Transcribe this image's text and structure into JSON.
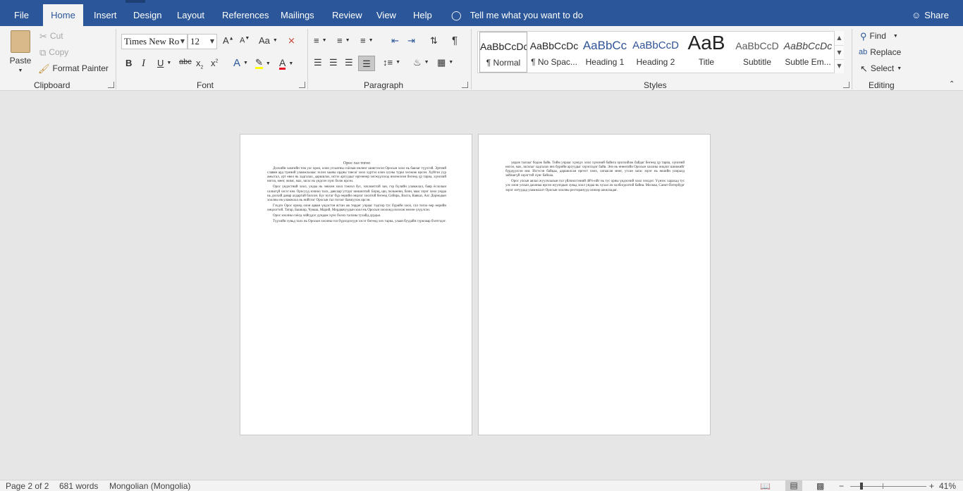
{
  "tabs": [
    {
      "label": "File",
      "active": false
    },
    {
      "label": "Home",
      "active": true
    },
    {
      "label": "Insert",
      "active": false
    },
    {
      "label": "Design",
      "active": false
    },
    {
      "label": "Layout",
      "active": false
    },
    {
      "label": "References",
      "active": false
    },
    {
      "label": "Mailings",
      "active": false
    },
    {
      "label": "Review",
      "active": false
    },
    {
      "label": "View",
      "active": false
    },
    {
      "label": "Help",
      "active": false
    }
  ],
  "tell_me": "Tell me what you want to do",
  "share_label": "Share",
  "clipboard": {
    "group_label": "Clipboard",
    "paste": "Paste",
    "cut": "Cut",
    "copy": "Copy",
    "format_painter": "Format Painter"
  },
  "font": {
    "group_label": "Font",
    "family": "Times New Ro",
    "size": "12"
  },
  "paragraph": {
    "group_label": "Paragraph"
  },
  "styles": {
    "group_label": "Styles",
    "items": [
      {
        "sample": "AaBbCcDc",
        "name": "¶ Normal",
        "selected": true
      },
      {
        "sample": "AaBbCcDc",
        "name": "¶ No Spac..."
      },
      {
        "sample": "AaBbCc",
        "name": "Heading 1"
      },
      {
        "sample": "AaBbCcD",
        "name": "Heading 2"
      },
      {
        "sample": "AaB",
        "name": "Title"
      },
      {
        "sample": "AaBbCcD",
        "name": "Subtitle"
      },
      {
        "sample": "AaBbCcDc",
        "name": "Subtle Em..."
      }
    ]
  },
  "editing": {
    "group_label": "Editing",
    "find": "Find",
    "replace": "Replace",
    "select": "Select"
  },
  "document": {
    "page1": {
      "title": "Орос гал тогоо",
      "paragraphs": [
        "Дэлхийн хамгийн том улс орон, олон угсаатны соёлын нөлөөг шингээсэн Оросын хоол нь баялаг түүхтэй. Эртний славян ард түмний уламжлалаас эхлэн хааны ордны тансаг хоол хүртэл олон зууны турш хөгжиж ирсэн. Хүйтэн уур амьсгал, урт өвөл нь хадгалах, даршилах, исгэх аргуудыг өргөнөөр хөгжүүлэхэд нөлөөлсөн бөгөөд үр тариа, хүнсний ногоо, мөөг, жимс, мах, загас нь үндсэн хүнс болж ирсэн.",
        "Орос үндэстний хоол, ундаа нь зөвхөн хоол тэжээл бус, зочломтгой зан, гэр бүлийн уламжлал, баяр ёслолын салшгүй хэсэг юм. Оросууд зочноо талх, давсаар угтдаг заншилтай. Борщ, щи, пельмени, блин, квас зэрэг хоол ундаа нь дэлхий даяар алдартай болсон. Бүс нутаг бүр өөрийн онцлог хоолтой бөгөөд Сибирь, Волга, Кавказ, Алс Дорнодын хоолны өв уламжлал нь нийтлэг Оросын гал тогоог баяжуулж ирсэн.",
        "Гэхдээ Орос оронд олон арван үндэстэн ястан аж төрдөг учраас тэдгээр тус бүрийн хоол, гал тогоо өөр өөрийн онцлогтой. Татар, Башкир, Чуваш, Марий, Мордвачуудын хоол нь Оросын хоолонд ихээхэн нөлөө үзүүлсэн.",
        "Орос хоолны соёлд хийгддэг дундаж хүнс болох талхны тухайд дурдья.",
        "Түүхийн хувьд талх нь Оросын хоолны гол бүрэлдэхүүн хэсэг бөгөөд хөх тариа, улаан буудайн гурилаар бэлтгэдэг."
      ]
    },
    "page2": {
      "paragraphs": [
        "уядаж талхыг бодож байв. Тийм учраас хүмүүс хоол хүнсний байнга эрэлхийлж байдаг бөгөөд үр тариа, хүнсний ногоо, мах, загасыг хадгалах янз бүрийн аргуудыг хэрэглэдэг байв. Энэ нь өнөөгийн Оросын хоолны онцлог шинжийг бүрдүүлсэн юм. Исгэсэн байцаа, даршилсан өргөст хэмх, хатаасан мөөг, утсан загас зэрэг нь өвлийн улиралд зайлшгүй хэрэгтэй хүнс байлаа.",
        "Орос улсын аялал жуулчлалын гол үйлчилгээний 48%-ийг нь тус орны үндэсний хоол эзэлдэг. Үүнээс харахад тус улс олон улсын дахинаа ирсэн жуулчдын хувьд хоол ундаа нь чухал ач холбогдолтой байна. Москва, Санкт-Петербург зэрэг хотуудад уламжлалт Оросын хоолны ресторанууд олноор ажилладаг."
      ]
    }
  },
  "status": {
    "page": "Page 2 of 2",
    "words": "681 words",
    "language": "Mongolian (Mongolia)",
    "zoom": "41%"
  }
}
